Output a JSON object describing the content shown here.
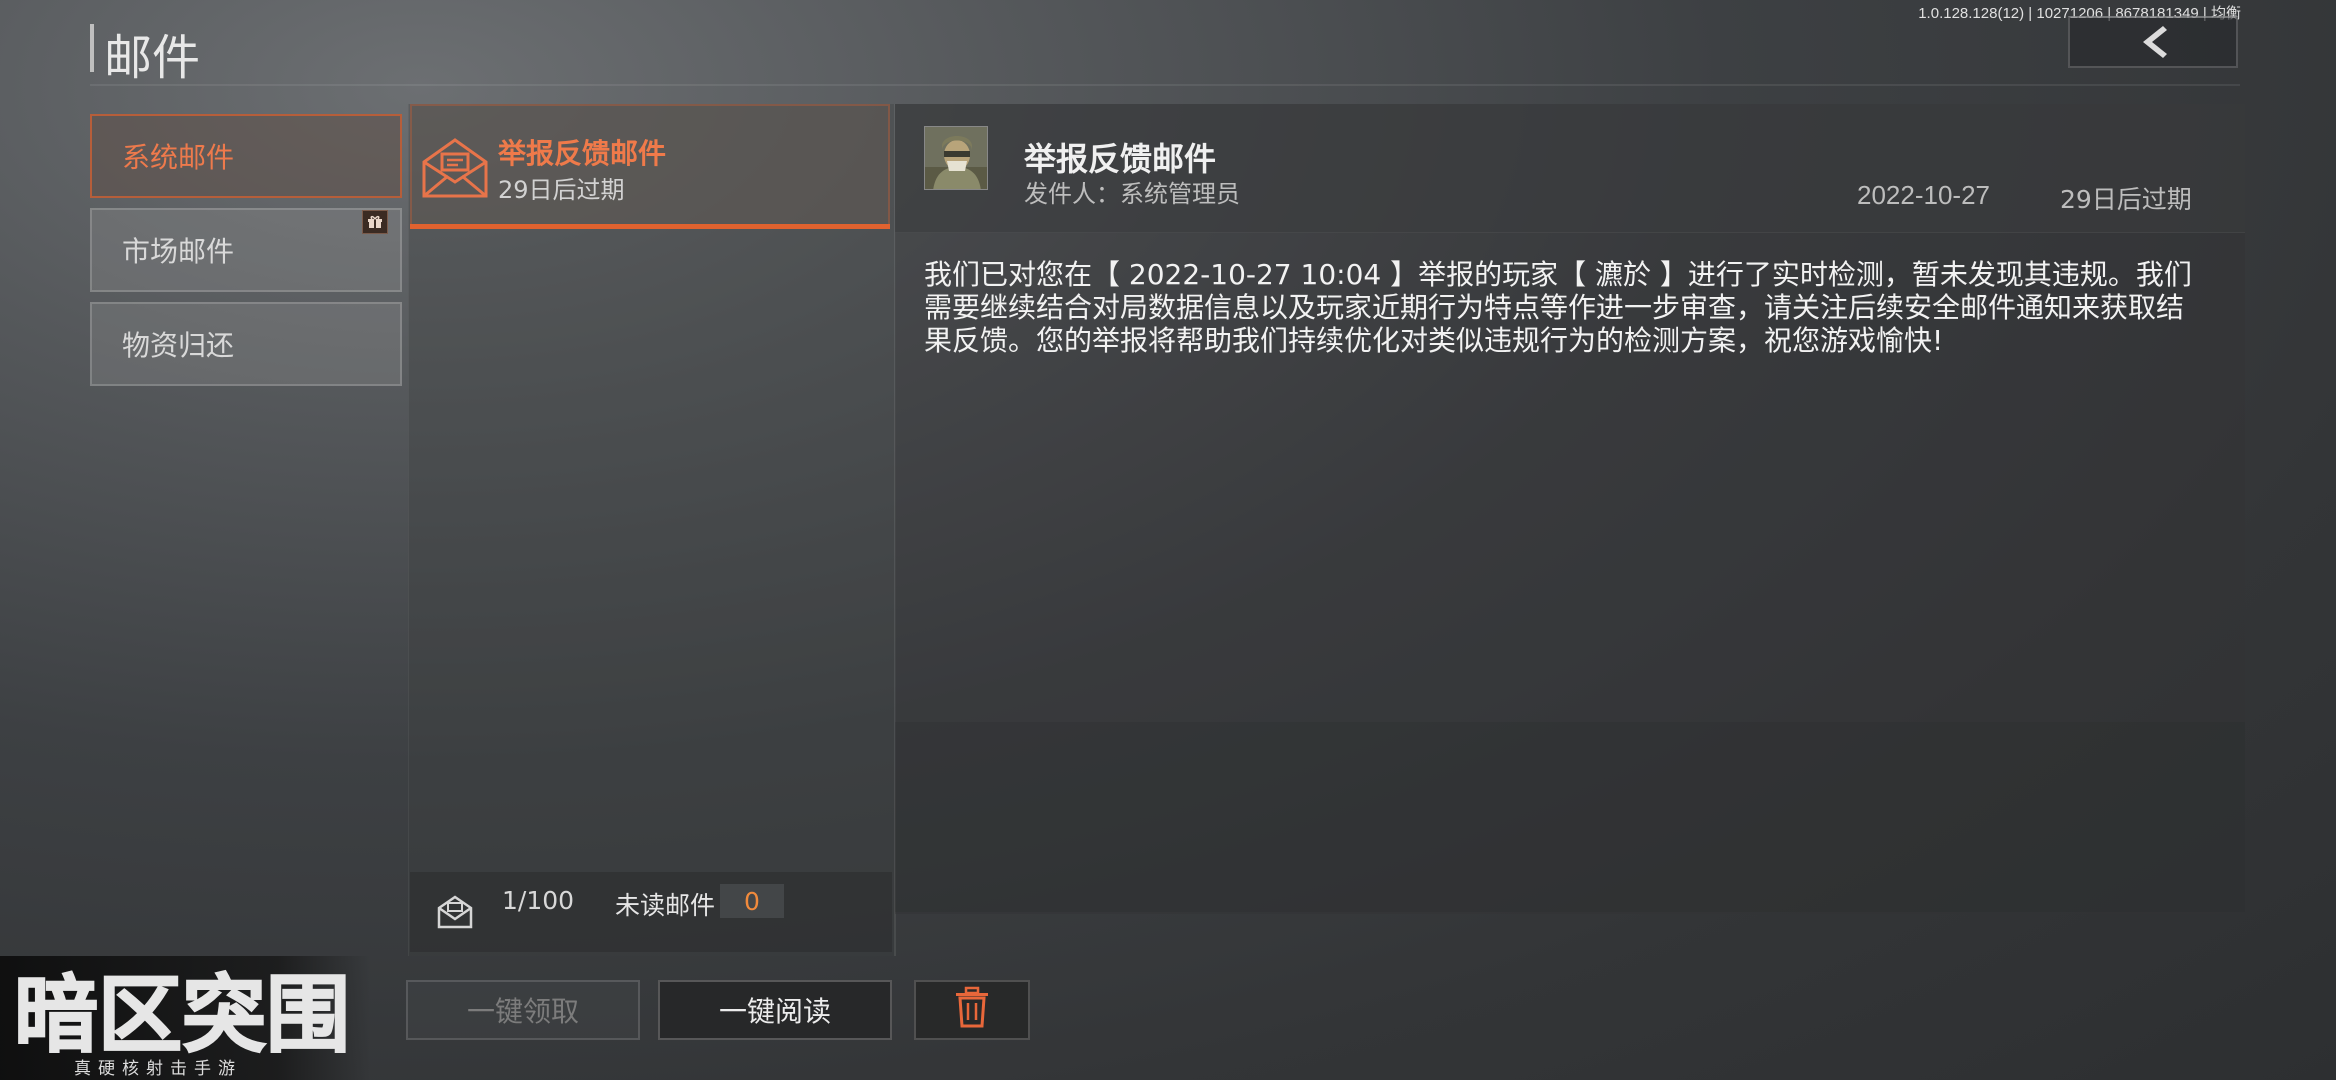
{
  "header": {
    "title": "邮件",
    "version": "1.0.128.128(12) | 10271206 | 8678181349 | 均衡",
    "back_icon": "chevron-left-icon"
  },
  "categories": [
    {
      "label": "系统邮件",
      "active": true
    },
    {
      "label": "市场邮件",
      "active": false,
      "badge_icon": "gift-icon"
    },
    {
      "label": "物资归还",
      "active": false
    }
  ],
  "mail_list": {
    "items": [
      {
        "title": "举报反馈邮件",
        "expiry": "29日后过期",
        "icon": "envelope-icon",
        "selected": true
      }
    ],
    "count": "1/100",
    "unread_label": "未读邮件",
    "unread_count": "0"
  },
  "detail": {
    "title": "举报反馈邮件",
    "sender": "发件人：系统管理员",
    "date": "2022-10-27",
    "expiry": "29日后过期",
    "body": "我们已对您在【 2022-10-27 10:04 】举报的玩家【 瀌於 】进行了实时检测，暂未发现其违规。我们需要继续结合对局数据信息以及玩家近期行为特点等作进一步审查，请关注后续安全邮件通知来获取结果反馈。您的举报将帮助我们持续优化对类似违规行为的检测方案，祝您游戏愉快!"
  },
  "actions": {
    "claim_all": "一键领取",
    "read_all": "一键阅读",
    "delete_icon": "trash-icon"
  },
  "logo": {
    "title": "暗区突围",
    "subtitle": "真硬核射击手游"
  },
  "colors": {
    "accent": "#ee7a4c",
    "unread_count": "#f08a3c"
  }
}
